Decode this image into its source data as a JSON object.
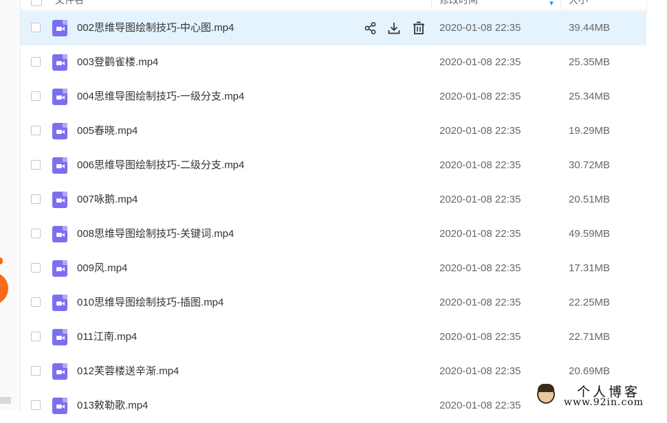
{
  "header": {
    "col_name": "文件名",
    "col_modified": "修改时间",
    "col_size": "大小"
  },
  "actions": {
    "share": "share-icon",
    "download": "download-icon",
    "delete": "delete-icon"
  },
  "files": [
    {
      "name": "002思维导图绘制技巧-中心图.mp4",
      "modified": "2020-01-08 22:35",
      "size": "39.44MB"
    },
    {
      "name": "003登鹳雀楼.mp4",
      "modified": "2020-01-08 22:35",
      "size": "25.35MB"
    },
    {
      "name": "004思维导图绘制技巧-一级分支.mp4",
      "modified": "2020-01-08 22:35",
      "size": "25.34MB"
    },
    {
      "name": "005春晓.mp4",
      "modified": "2020-01-08 22:35",
      "size": "19.29MB"
    },
    {
      "name": "006思维导图绘制技巧-二级分支.mp4",
      "modified": "2020-01-08 22:35",
      "size": "30.72MB"
    },
    {
      "name": "007咏鹅.mp4",
      "modified": "2020-01-08 22:35",
      "size": "20.51MB"
    },
    {
      "name": "008思维导图绘制技巧-关键词.mp4",
      "modified": "2020-01-08 22:35",
      "size": "49.59MB"
    },
    {
      "name": "009风.mp4",
      "modified": "2020-01-08 22:35",
      "size": "17.31MB"
    },
    {
      "name": "010思维导图绘制技巧-插图.mp4",
      "modified": "2020-01-08 22:35",
      "size": "22.25MB"
    },
    {
      "name": "011江南.mp4",
      "modified": "2020-01-08 22:35",
      "size": "22.71MB"
    },
    {
      "name": "012芙蓉楼送辛渐.mp4",
      "modified": "2020-01-08 22:35",
      "size": "20.69MB"
    },
    {
      "name": "013敕勒歌.mp4",
      "modified": "2020-01-08 22:35",
      "size": ""
    }
  ],
  "watermark": {
    "title": "个人博客",
    "url": "www.92in.com"
  },
  "colors": {
    "hover_row": "#e5f3ff",
    "video_icon": "#7b6ff0",
    "accent": "#f56c1a"
  }
}
